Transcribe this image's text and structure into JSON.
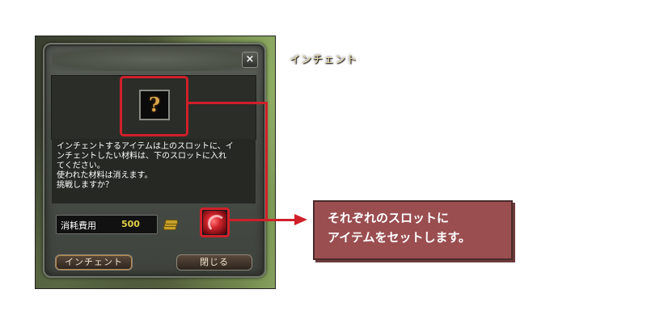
{
  "dialog": {
    "title": "インチェント",
    "close_label": "×",
    "main_slot_icon": "question-mark-icon",
    "description_lines": [
      "インチェントするアイテムは上のスロットに、イ",
      "ンチェントしたい材料は、下のスロットに入れ",
      "てください。",
      "使われた材料は消えます。",
      "挑戦しますか？"
    ],
    "cost_label": "消耗費用",
    "cost_value": "500",
    "coin_icon": "gold-coins-icon",
    "material_slot_icon": "red-swirl-gem-icon",
    "enchant_button_label": "インチェント",
    "close_button_label": "閉じる"
  },
  "callout": {
    "lines": [
      "それぞれのスロットに",
      "アイテムをセットします。"
    ],
    "color": "#9a4e50"
  },
  "colors": {
    "highlight": "#d0202a",
    "cost_value": "#e4d04a",
    "title_text": "#e9d9a8"
  }
}
